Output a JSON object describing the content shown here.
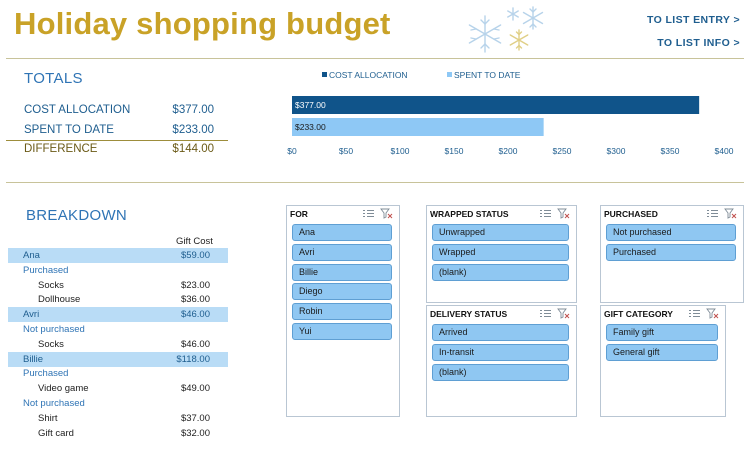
{
  "header": {
    "title": "Holiday shopping budget",
    "links": [
      "TO LIST ENTRY >",
      "TO LIST INFO >"
    ]
  },
  "totals": {
    "heading": "TOTALS",
    "rows": [
      {
        "label": "COST ALLOCATION",
        "value": "$377.00"
      },
      {
        "label": "SPENT TO DATE",
        "value": "$233.00"
      },
      {
        "label": "DIFFERENCE",
        "value": "$144.00"
      }
    ]
  },
  "chart_data": {
    "type": "bar",
    "orientation": "horizontal",
    "series": [
      {
        "name": "COST ALLOCATION",
        "value": 377,
        "label": "$377.00",
        "color": "#10548a"
      },
      {
        "name": "SPENT TO DATE",
        "value": 233,
        "label": "$233.00",
        "color": "#8ec8f5"
      }
    ],
    "xlim": [
      0,
      400
    ],
    "ticks": [
      "$0",
      "$50",
      "$100",
      "$150",
      "$200",
      "$250",
      "$300",
      "$350",
      "$400"
    ],
    "legend_position": "top",
    "grid": false
  },
  "breakdown": {
    "heading": "BREAKDOWN",
    "column_header": "Gift Cost",
    "rows": [
      {
        "kind": "person",
        "label": "Ana",
        "amount": "$59.00"
      },
      {
        "kind": "status",
        "label": "Purchased",
        "amount": ""
      },
      {
        "kind": "item",
        "label": "Socks",
        "amount": "$23.00"
      },
      {
        "kind": "item",
        "label": "Dollhouse",
        "amount": "$36.00"
      },
      {
        "kind": "person",
        "label": "Avri",
        "amount": "$46.00"
      },
      {
        "kind": "status",
        "label": "Not purchased",
        "amount": ""
      },
      {
        "kind": "item",
        "label": "Socks",
        "amount": "$46.00"
      },
      {
        "kind": "person",
        "label": "Billie",
        "amount": "$118.00"
      },
      {
        "kind": "status",
        "label": "Purchased",
        "amount": ""
      },
      {
        "kind": "item",
        "label": "Video game",
        "amount": "$49.00"
      },
      {
        "kind": "status",
        "label": "Not purchased",
        "amount": ""
      },
      {
        "kind": "item",
        "label": "Shirt",
        "amount": "$37.00"
      },
      {
        "kind": "item",
        "label": "Gift card",
        "amount": "$32.00"
      }
    ]
  },
  "slicers": {
    "for": {
      "title": "FOR",
      "items": [
        "Ana",
        "Avri",
        "Billie",
        "Diego",
        "Robin",
        "Yui"
      ]
    },
    "wrapped": {
      "title": "WRAPPED STATUS",
      "items": [
        "Unwrapped",
        "Wrapped",
        "(blank)"
      ]
    },
    "purchased": {
      "title": "PURCHASED",
      "items": [
        "Not purchased",
        "Purchased"
      ]
    },
    "delivery": {
      "title": "DELIVERY STATUS",
      "items": [
        "Arrived",
        "In-transit",
        "(blank)"
      ]
    },
    "category": {
      "title": "GIFT CATEGORY",
      "items": [
        "Family gift",
        "General gift"
      ]
    }
  },
  "colors": {
    "title_gold": "#c9a227",
    "accent_blue": "#2f74b5",
    "bar_dark": "#10548a",
    "bar_light": "#8ec8f5",
    "slicer_button": "#8fc7f2"
  }
}
